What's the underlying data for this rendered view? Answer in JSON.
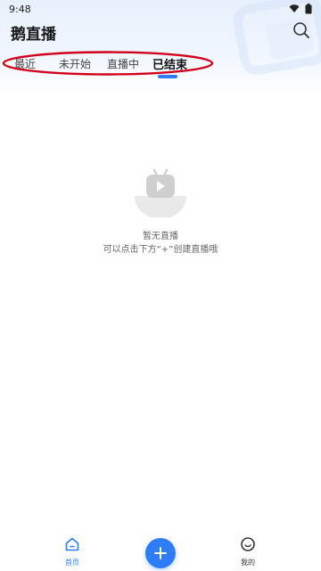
{
  "status_bar": {
    "time": "9:48"
  },
  "header": {
    "title": "鹅直播"
  },
  "tabs": [
    {
      "label": "最近",
      "active": false
    },
    {
      "label": "未开始",
      "active": false
    },
    {
      "label": "直播中",
      "active": false
    },
    {
      "label": "已结束",
      "active": true
    }
  ],
  "empty_state": {
    "title": "暂无直播",
    "subtitle": "可以点击下方“+”创建直播哦"
  },
  "bottom_nav": {
    "home_label": "首页",
    "me_label": "我的"
  },
  "colors": {
    "accent": "#2e7cf6",
    "annotation_red": "#d0021b"
  },
  "icons": [
    "search-icon",
    "wifi-icon",
    "battery-icon",
    "tv-play-icon",
    "home-icon",
    "plus-icon",
    "smile-icon"
  ]
}
